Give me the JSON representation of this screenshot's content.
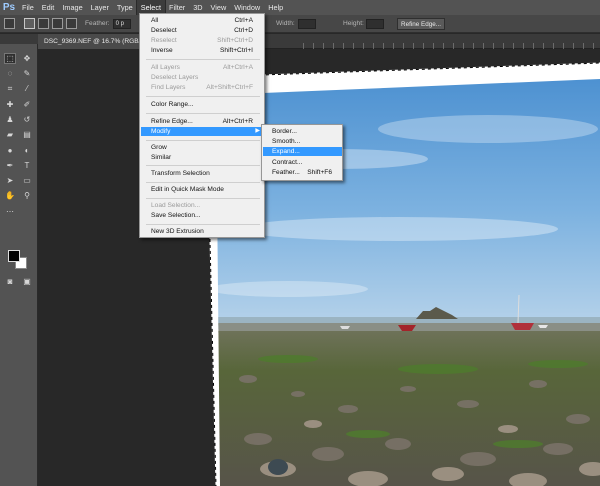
{
  "app": {
    "logo": "Ps"
  },
  "menubar": {
    "items": [
      "File",
      "Edit",
      "Image",
      "Layer",
      "Type",
      "Select",
      "Filter",
      "3D",
      "View",
      "Window",
      "Help"
    ],
    "active": "Select"
  },
  "options_bar": {
    "feather_label": "Feather:",
    "feather_value": "0 p",
    "width_label": "Width:",
    "height_label": "Height:",
    "refine_edge_button": "Refine Edge..."
  },
  "document": {
    "tab_title": "DSC_9369.NEF @ 16.7% (RGB/8"
  },
  "select_menu": {
    "items": [
      {
        "label": "All",
        "shortcut": "Ctrl+A",
        "enabled": true
      },
      {
        "label": "Deselect",
        "shortcut": "Ctrl+D",
        "enabled": true
      },
      {
        "label": "Reselect",
        "shortcut": "Shift+Ctrl+D",
        "enabled": false
      },
      {
        "label": "Inverse",
        "shortcut": "Shift+Ctrl+I",
        "enabled": true
      },
      {
        "label": "All Layers",
        "shortcut": "Alt+Ctrl+A",
        "enabled": false
      },
      {
        "label": "Deselect Layers",
        "shortcut": "",
        "enabled": false
      },
      {
        "label": "Find Layers",
        "shortcut": "Alt+Shift+Ctrl+F",
        "enabled": false
      },
      {
        "label": "Color Range...",
        "shortcut": "",
        "enabled": true
      },
      {
        "label": "Refine Edge...",
        "shortcut": "Alt+Ctrl+R",
        "enabled": true
      },
      {
        "label": "Modify",
        "shortcut": "",
        "enabled": true,
        "highlighted": true
      },
      {
        "label": "Grow",
        "shortcut": "",
        "enabled": true
      },
      {
        "label": "Similar",
        "shortcut": "",
        "enabled": true
      },
      {
        "label": "Transform Selection",
        "shortcut": "",
        "enabled": true
      },
      {
        "label": "Edit in Quick Mask Mode",
        "shortcut": "",
        "enabled": true
      },
      {
        "label": "Load Selection...",
        "shortcut": "",
        "enabled": false
      },
      {
        "label": "Save Selection...",
        "shortcut": "",
        "enabled": true
      },
      {
        "label": "New 3D Extrusion",
        "shortcut": "",
        "enabled": true
      }
    ]
  },
  "modify_submenu": {
    "items": [
      {
        "label": "Border...",
        "shortcut": ""
      },
      {
        "label": "Smooth...",
        "shortcut": ""
      },
      {
        "label": "Expand...",
        "shortcut": "",
        "highlighted": true
      },
      {
        "label": "Contract...",
        "shortcut": ""
      },
      {
        "label": "Feather...",
        "shortcut": "Shift+F6"
      }
    ]
  },
  "colors": {
    "highlight": "#3399ff",
    "menu_bg": "#f0f0f0",
    "ui_dark": "#535353",
    "canvas_bg": "#282828"
  }
}
